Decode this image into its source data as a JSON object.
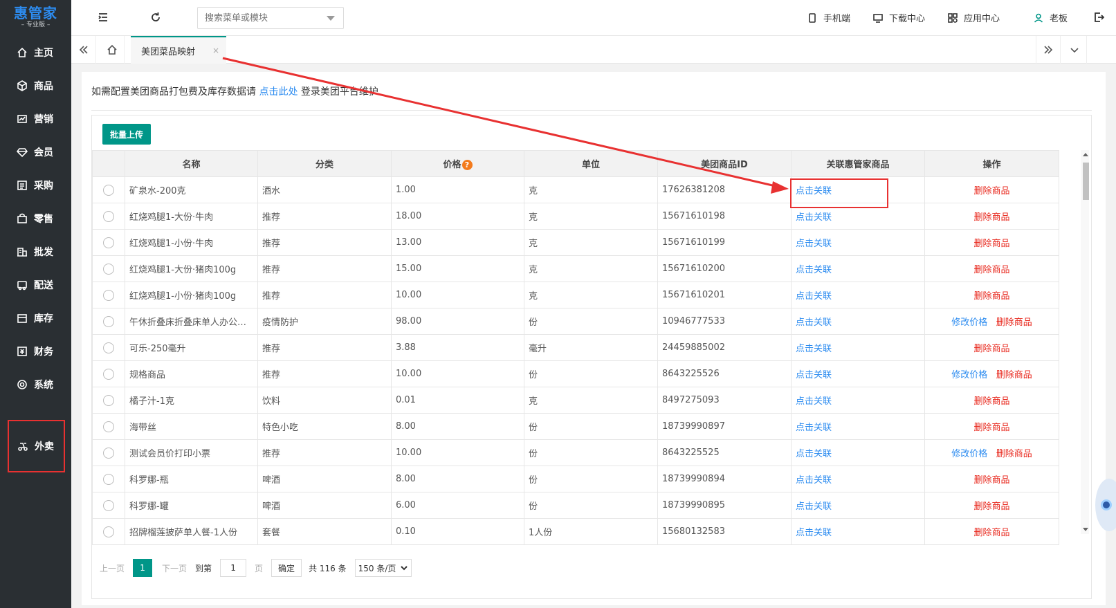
{
  "brand": {
    "name": "惠管家",
    "edition": "专业版"
  },
  "sidebar": {
    "items": [
      {
        "label": "主页",
        "icon": "home-icon"
      },
      {
        "label": "商品",
        "icon": "box-icon"
      },
      {
        "label": "营销",
        "icon": "chart-icon"
      },
      {
        "label": "会员",
        "icon": "diamond-icon"
      },
      {
        "label": "采购",
        "icon": "list-icon"
      },
      {
        "label": "零售",
        "icon": "bag-icon"
      },
      {
        "label": "批发",
        "icon": "building-icon"
      },
      {
        "label": "配送",
        "icon": "truck-icon"
      },
      {
        "label": "库存",
        "icon": "warehouse-icon"
      },
      {
        "label": "财务",
        "icon": "finance-icon"
      },
      {
        "label": "系统",
        "icon": "gear-icon"
      },
      {
        "label": "外卖",
        "icon": "delivery-icon"
      }
    ]
  },
  "topbar": {
    "search_placeholder": "搜索菜单或模块",
    "mobile": "手机端",
    "download": "下载中心",
    "apps": "应用中心",
    "user": "老板"
  },
  "tabs": {
    "active": "美团菜品映射",
    "close": "×"
  },
  "notice": {
    "prefix": "如需配置美团商品打包费及库存数据请 ",
    "link": "点击此处",
    "suffix": " 登录美团平台维护"
  },
  "toolbar": {
    "upload_label": "批量上传"
  },
  "table": {
    "columns": [
      "名称",
      "分类",
      "价格",
      "单位",
      "美团商品ID",
      "关联惠管家商品",
      "操作"
    ],
    "price_help": "?",
    "link_label": "点击关联",
    "delete_label": "删除商品",
    "edit_label": "修改价格",
    "rows": [
      {
        "name": "矿泉水-200克",
        "category": "酒水",
        "price": "1.00",
        "unit": "克",
        "id": "17626381208",
        "edit": false
      },
      {
        "name": "红烧鸡腿1-大份·牛肉",
        "category": "推荐",
        "price": "18.00",
        "unit": "克",
        "id": "15671610198",
        "edit": false
      },
      {
        "name": "红烧鸡腿1-小份·牛肉",
        "category": "推荐",
        "price": "13.00",
        "unit": "克",
        "id": "15671610199",
        "edit": false
      },
      {
        "name": "红烧鸡腿1-大份·猪肉100g",
        "category": "推荐",
        "price": "15.00",
        "unit": "克",
        "id": "15671610200",
        "edit": false
      },
      {
        "name": "红烧鸡腿1-小份·猪肉100g",
        "category": "推荐",
        "price": "10.00",
        "unit": "克",
        "id": "15671610201",
        "edit": false
      },
      {
        "name": "午休折叠床折叠床单人办公室午睡床",
        "category": "疫情防护",
        "price": "98.00",
        "unit": "份",
        "id": "10946777533",
        "edit": true
      },
      {
        "name": "可乐-250毫升",
        "category": "推荐",
        "price": "3.88",
        "unit": "毫升",
        "id": "24459885002",
        "edit": false
      },
      {
        "name": "规格商品",
        "category": "推荐",
        "price": "10.00",
        "unit": "份",
        "id": "8643225526",
        "edit": true
      },
      {
        "name": "橘子汁-1克",
        "category": "饮料",
        "price": "0.01",
        "unit": "克",
        "id": "8497275093",
        "edit": false
      },
      {
        "name": "海带丝",
        "category": "特色小吃",
        "price": "8.00",
        "unit": "份",
        "id": "18739990897",
        "edit": false
      },
      {
        "name": "测试会员价打印小票",
        "category": "推荐",
        "price": "10.00",
        "unit": "份",
        "id": "8643225525",
        "edit": true
      },
      {
        "name": "科罗娜-瓶",
        "category": "啤酒",
        "price": "8.00",
        "unit": "份",
        "id": "18739990894",
        "edit": false
      },
      {
        "name": "科罗娜-罐",
        "category": "啤酒",
        "price": "6.00",
        "unit": "份",
        "id": "18739990895",
        "edit": false
      },
      {
        "name": "招牌榴莲披萨单人餐-1人份",
        "category": "套餐",
        "price": "0.10",
        "unit": "1人份",
        "id": "15680132583",
        "edit": false
      }
    ]
  },
  "pager": {
    "prev": "上一页",
    "current": "1",
    "next": "下一页",
    "goto": "到第",
    "goto_value": "1",
    "page": "页",
    "confirm": "确定",
    "total": "共 116 条",
    "size": "150 条/页"
  }
}
